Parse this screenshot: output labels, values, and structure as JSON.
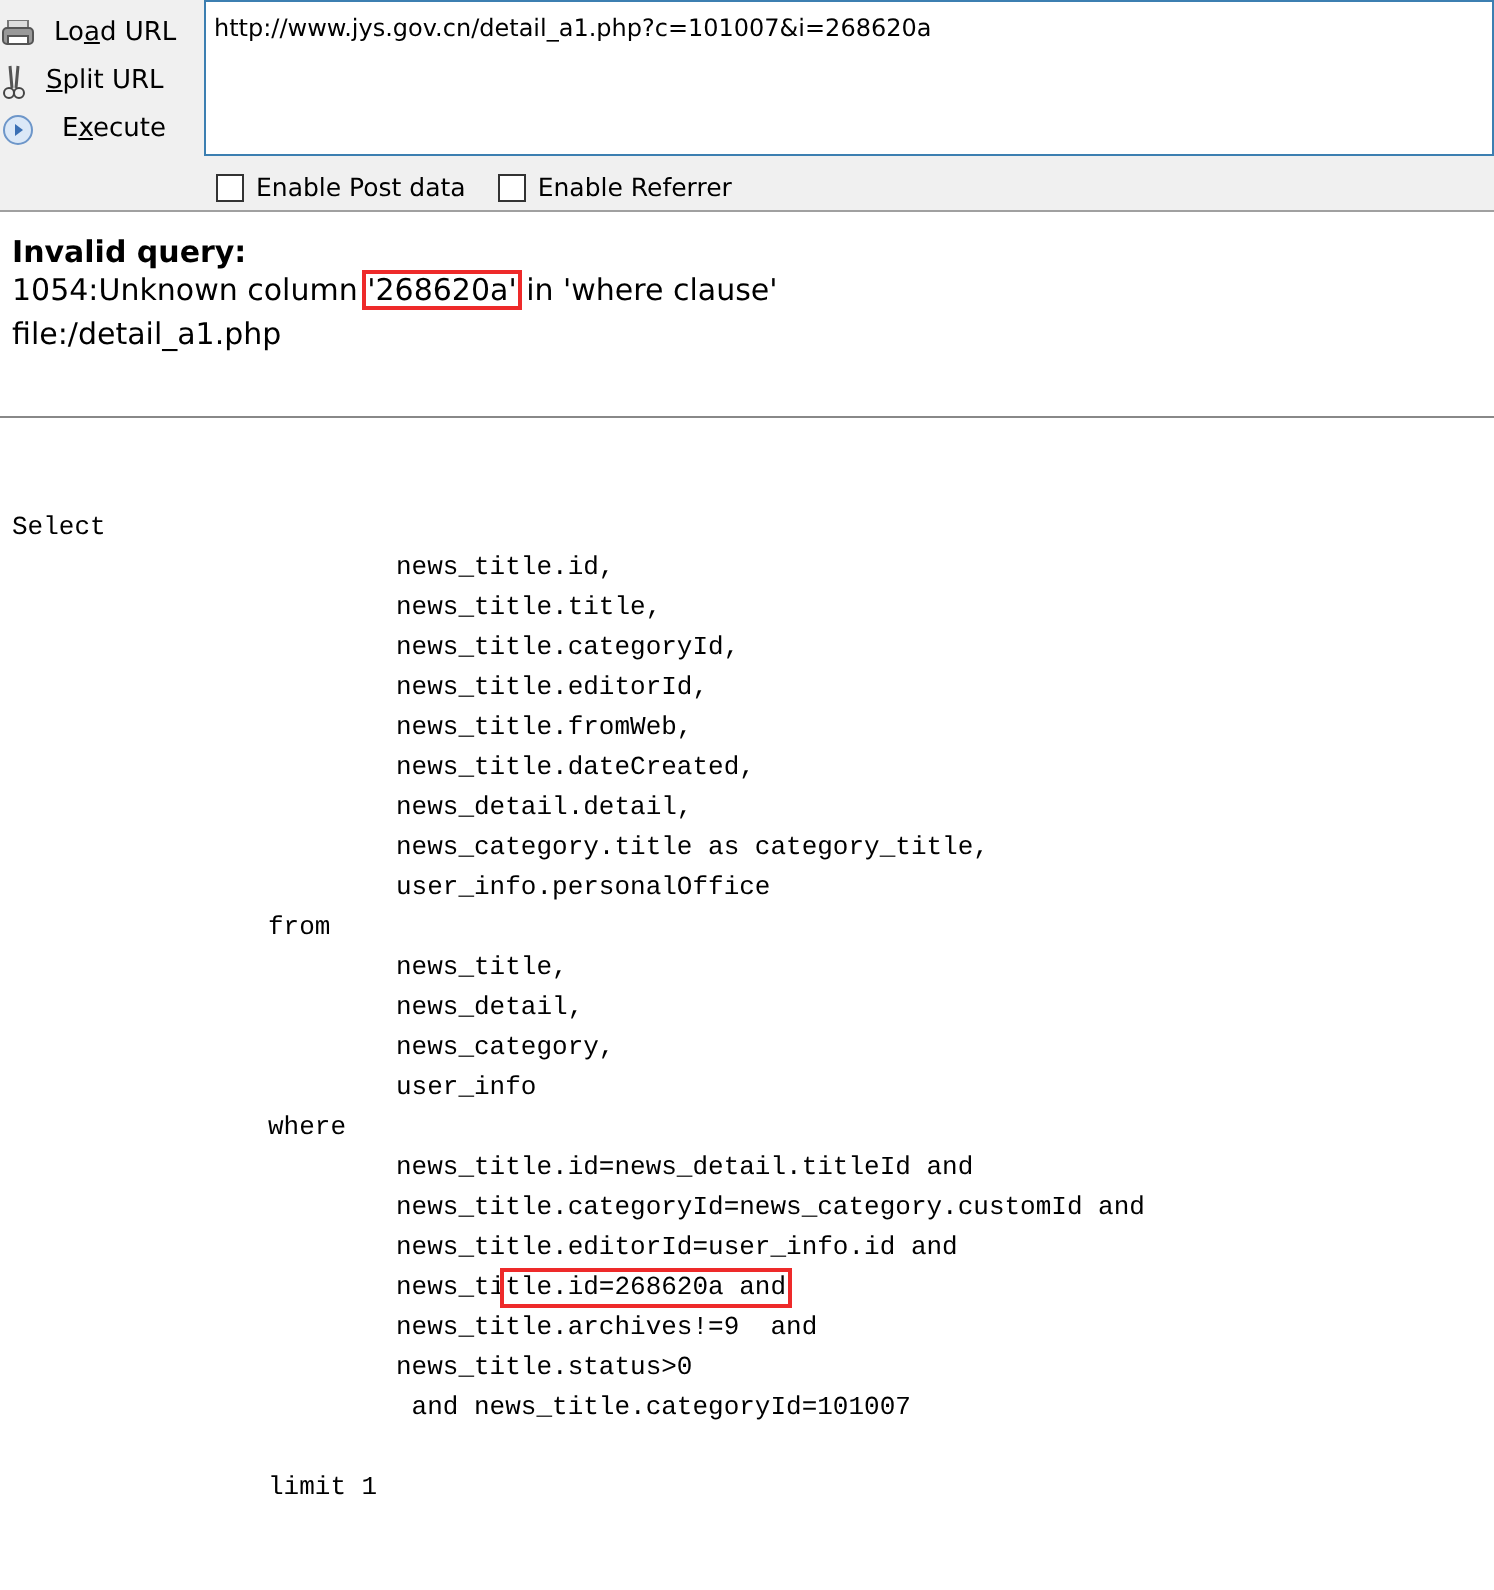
{
  "toolbar": {
    "actions": [
      {
        "kind": "load",
        "label": {
          "before": "Lo",
          "key": "a",
          "after": "d URL"
        }
      },
      {
        "kind": "split",
        "label": {
          "key": "S",
          "after": "plit URL"
        }
      },
      {
        "kind": "execute",
        "label": {
          "before": "E",
          "key": "x",
          "after": "ecute"
        }
      }
    ],
    "url": "http://www.jys.gov.cn/detail_a1.php?c=101007&i=268620a",
    "options": [
      {
        "label": "Enable Post data",
        "checked": false
      },
      {
        "label": "Enable Referrer",
        "checked": false
      }
    ]
  },
  "error": {
    "title": "Invalid query:",
    "message": [
      {
        "text": "1054:Unknown column ",
        "boxed": false
      },
      {
        "text": "'268620a'",
        "boxed": true
      },
      {
        "text": " in 'where clause'",
        "boxed": false
      }
    ],
    "file": "file:/detail_a1.php"
  },
  "sql": [
    {
      "kind": "statement",
      "keyword": "Select",
      "lines": [
        [
          {
            "text": "news_title.id,",
            "boxed": false
          }
        ],
        [
          {
            "text": "news_title.title,",
            "boxed": false
          }
        ],
        [
          {
            "text": "news_title.categoryId,",
            "boxed": false
          }
        ],
        [
          {
            "text": "news_title.editorId,",
            "boxed": false
          }
        ],
        [
          {
            "text": "news_title.fromWeb,",
            "boxed": false
          }
        ],
        [
          {
            "text": "news_title.dateCreated,",
            "boxed": false
          }
        ],
        [
          {
            "text": "news_detail.detail,",
            "boxed": false
          }
        ],
        [
          {
            "text": "news_category.title as category_title,",
            "boxed": false
          }
        ],
        [
          {
            "text": "user_info.personalOffice",
            "boxed": false
          }
        ]
      ]
    },
    {
      "kind": "clause",
      "keyword": "from",
      "lines": [
        [
          {
            "text": "news_title,",
            "boxed": false
          }
        ],
        [
          {
            "text": "news_detail,",
            "boxed": false
          }
        ],
        [
          {
            "text": "news_category,",
            "boxed": false
          }
        ],
        [
          {
            "text": "user_info",
            "boxed": false
          }
        ]
      ]
    },
    {
      "kind": "clause",
      "keyword": "where",
      "lines": [
        [
          {
            "text": "news_title.id=news_detail.titleId and",
            "boxed": false
          }
        ],
        [
          {
            "text": "news_title.categoryId=news_category.customId and",
            "boxed": false
          }
        ],
        [
          {
            "text": "news_title.editorId=user_info.id and",
            "boxed": false
          }
        ],
        [
          {
            "text": "news_ti",
            "boxed": false
          },
          {
            "text": "tle.id=268620a and",
            "boxed": true
          }
        ],
        [
          {
            "text": "news_title.archives!=9  and",
            "boxed": false
          }
        ],
        [
          {
            "text": "news_title.status>0",
            "boxed": false
          }
        ],
        [
          {
            "text": " and news_title.categoryId=101007",
            "boxed": false
          }
        ]
      ]
    },
    {
      "kind": "clause",
      "keyword": "limit 1"
    }
  ]
}
